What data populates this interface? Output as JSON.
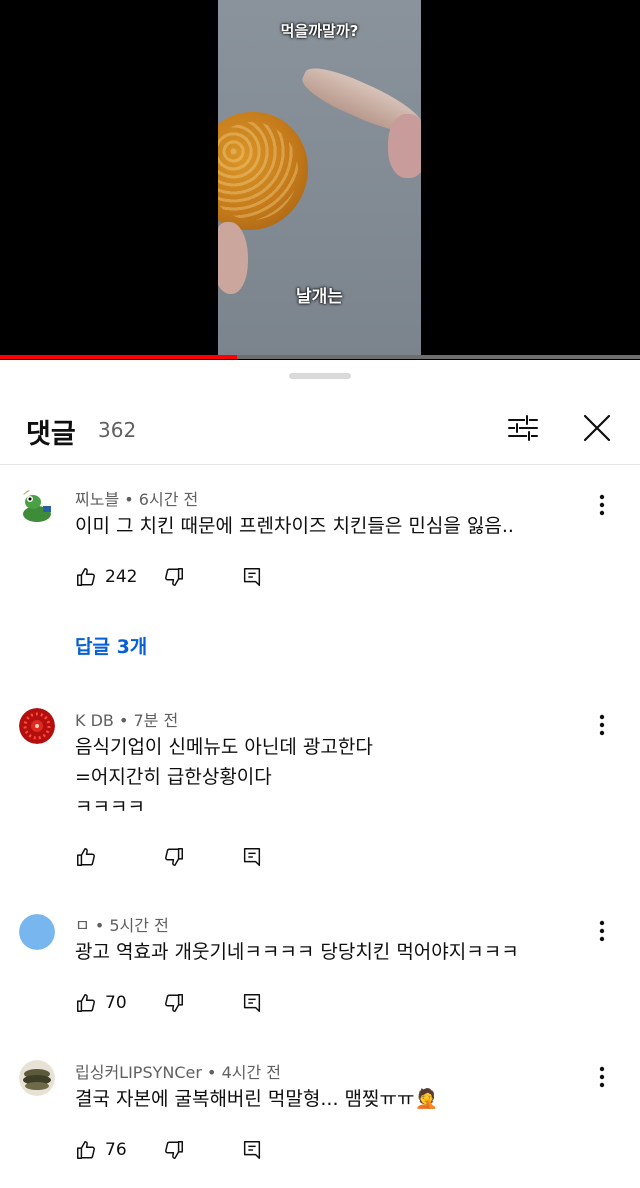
{
  "video": {
    "overlay_top": "먹을까말까?",
    "overlay_bottom": "날개는",
    "progress": 0.37,
    "colors": {
      "progress": "#ff0000",
      "track": "#6e6e6e"
    }
  },
  "comments_panel": {
    "title": "댓글",
    "count": "362"
  },
  "comments": [
    {
      "author": "찌노블",
      "time": "6시간 전",
      "lines": [
        "이미 그 치킨 때문에 프렌차이즈 치킨들은 민심을 잃음.."
      ],
      "likes": "242",
      "replies": "답글 3개",
      "avatar": "frog-avatar"
    },
    {
      "author": "K DB",
      "time": "7분 전",
      "lines": [
        "음식기업이 신메뉴도 아닌데 광고한다",
        "=어지간히 급한상황이다",
        "ㅋㅋㅋㅋ"
      ],
      "likes": "",
      "avatar": "red-pattern-avatar"
    },
    {
      "author": "ㅁ",
      "time": "5시간 전",
      "lines": [
        "광고 역효과 개웃기네ㅋㅋㅋㅋ 당당치킨 먹어야지ㅋㅋㅋ"
      ],
      "likes": "70",
      "avatar": "blue-circle-avatar"
    },
    {
      "author": "립싱커LIPSYNCer",
      "time": "4시간 전",
      "lines": [
        "결국 자본에 굴복해버린 먹말형... 맴찢ㅠㅠ🤦"
      ],
      "likes": "76",
      "avatar": "lips-avatar"
    }
  ]
}
